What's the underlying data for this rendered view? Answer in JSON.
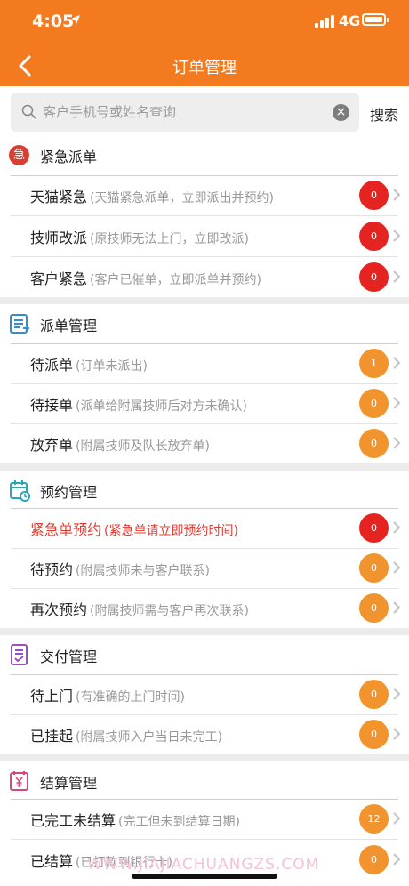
{
  "status_bar": {
    "time": "4:05",
    "network": "4G"
  },
  "header": {
    "title": "订单管理"
  },
  "search": {
    "placeholder": "客户手机号或姓名查询",
    "value": "",
    "button_label": "搜索"
  },
  "sections": [
    {
      "title": "紧急派单",
      "icon": "urgent-icon",
      "icon_text": "急",
      "items": [
        {
          "label": "天猫紧急",
          "desc": "(天猫紧急派单，立即派出并预约)",
          "count": "0",
          "badge_color": "red"
        },
        {
          "label": "技师改派",
          "desc": "(原技师无法上门，立即改派)",
          "count": "0",
          "badge_color": "red"
        },
        {
          "label": "客户紧急",
          "desc": "(客户已催单，立即派单并预约)",
          "count": "0",
          "badge_color": "red"
        }
      ]
    },
    {
      "title": "派单管理",
      "icon": "dispatch-list-icon",
      "items": [
        {
          "label": "待派单",
          "desc": "(订单未派出)",
          "count": "1",
          "badge_color": "orange"
        },
        {
          "label": "待接单",
          "desc": "(派单给附属技师后对方未确认)",
          "count": "0",
          "badge_color": "orange"
        },
        {
          "label": "放弃单",
          "desc": "(附属技师及队长放弃单)",
          "count": "0",
          "badge_color": "orange"
        }
      ]
    },
    {
      "title": "预约管理",
      "icon": "calendar-icon",
      "items": [
        {
          "label": "紧急单预约",
          "desc": "(紧急单请立即预约时间)",
          "count": "0",
          "badge_color": "red",
          "highlight": true
        },
        {
          "label": "待预约",
          "desc": "(附属技师未与客户联系)",
          "count": "0",
          "badge_color": "orange"
        },
        {
          "label": "再次预约",
          "desc": "(附属技师需与客户再次联系)",
          "count": "0",
          "badge_color": "orange"
        }
      ]
    },
    {
      "title": "交付管理",
      "icon": "delivery-doc-icon",
      "items": [
        {
          "label": "待上门",
          "desc": "(有准确的上门时间)",
          "count": "0",
          "badge_color": "orange"
        },
        {
          "label": "已挂起",
          "desc": "(附属技师入户当日未完工)",
          "count": "0",
          "badge_color": "orange"
        }
      ]
    },
    {
      "title": "结算管理",
      "icon": "settlement-yen-icon",
      "items": [
        {
          "label": "已完工未结算",
          "desc": "(完工但未到结算日期)",
          "count": "12",
          "badge_color": "orange"
        },
        {
          "label": "已结算",
          "desc": "(已打款到银行卡)",
          "count": "0",
          "badge_color": "orange"
        }
      ]
    }
  ],
  "watermark": "WWW.JIAJIACHUANGZS.COM",
  "colors": {
    "primary": "#f47a1f",
    "badge_red": "#e52421",
    "badge_orange": "#f2942e",
    "highlight_text": "#e23b30"
  }
}
